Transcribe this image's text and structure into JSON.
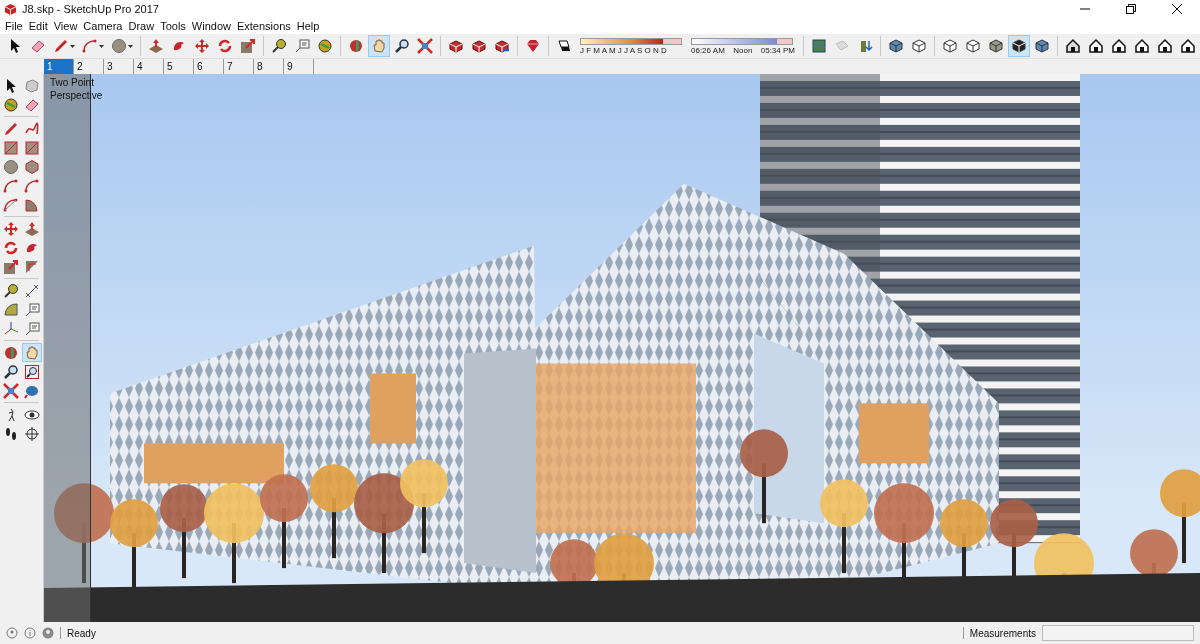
{
  "window": {
    "title": "J8.skp - SketchUp Pro 2017"
  },
  "menu": [
    "File",
    "Edit",
    "View",
    "Camera",
    "Draw",
    "Tools",
    "Window",
    "Extensions",
    "Help"
  ],
  "main_toolbar": {
    "tools": [
      {
        "selected": false
      },
      {
        "selected": false
      },
      {
        "selected": false
      },
      {
        "selected": false
      },
      {
        "selected": false
      },
      {
        "selected": false
      },
      {
        "selected": false
      },
      {
        "selected": false
      },
      {
        "selected": false
      },
      {
        "selected": false
      },
      {
        "selected": false
      },
      {
        "selected": false
      },
      {
        "selected": false
      },
      {
        "selected": false
      },
      {
        "selected": true
      },
      {
        "selected": false
      },
      {
        "selected": false
      },
      {
        "selected": false
      },
      {
        "selected": false
      },
      {
        "selected": false
      },
      {
        "selected": false
      },
      {
        "selected": false
      },
      {
        "selected": false
      },
      {
        "selected": false
      },
      {
        "selected": false
      },
      {
        "selected": false
      },
      {
        "selected": false
      },
      {
        "selected": false
      },
      {
        "selected": false
      },
      {
        "selected": false
      },
      {
        "selected": true
      },
      {
        "selected": false
      },
      {
        "selected": false
      },
      {
        "selected": false
      },
      {
        "selected": false
      },
      {
        "selected": false
      },
      {
        "selected": false
      },
      {
        "selected": false
      }
    ]
  },
  "shadow_settings": {
    "month_slider": {
      "level": 0.82
    },
    "time_slider": {
      "level": 0.85
    },
    "months": "J F M A M J J A S O N D",
    "time_start": "06:26 AM",
    "time_mid": "Noon",
    "time_end": "05:34 PM"
  },
  "scene_tabs": [
    {
      "label": "1",
      "selected": true
    },
    {
      "label": "2",
      "selected": false
    },
    {
      "label": "3",
      "selected": false
    },
    {
      "label": "4",
      "selected": false
    },
    {
      "label": "5",
      "selected": false
    },
    {
      "label": "6",
      "selected": false
    },
    {
      "label": "7",
      "selected": false
    },
    {
      "label": "8",
      "selected": false
    },
    {
      "label": "9",
      "selected": false
    }
  ],
  "left_toolbar": {
    "tools": [
      {
        "selected": false
      },
      {
        "selected": false
      },
      {
        "selected": false
      },
      {
        "selected": false
      },
      {
        "selected": false
      },
      {
        "selected": false
      },
      {
        "selected": false
      },
      {
        "selected": false
      },
      {
        "selected": false
      },
      {
        "selected": false
      },
      {
        "selected": false
      },
      {
        "selected": false
      },
      {
        "selected": false
      },
      {
        "selected": false
      },
      {
        "selected": false
      },
      {
        "selected": false
      },
      {
        "selected": false
      },
      {
        "selected": false
      },
      {
        "selected": false
      },
      {
        "selected": false
      },
      {
        "selected": false
      },
      {
        "selected": false
      },
      {
        "selected": false
      },
      {
        "selected": false
      },
      {
        "selected": false
      },
      {
        "selected": false
      },
      {
        "selected": false
      },
      {
        "selected": true
      },
      {
        "selected": false
      },
      {
        "selected": false
      },
      {
        "selected": false
      },
      {
        "selected": false
      },
      {
        "selected": false
      },
      {
        "selected": false
      },
      {
        "selected": false
      },
      {
        "selected": false
      }
    ]
  },
  "viewport": {
    "camera_label": "Two Point Perspective"
  },
  "status_bar": {
    "status": "Ready",
    "measurements_label": "Measurements"
  }
}
